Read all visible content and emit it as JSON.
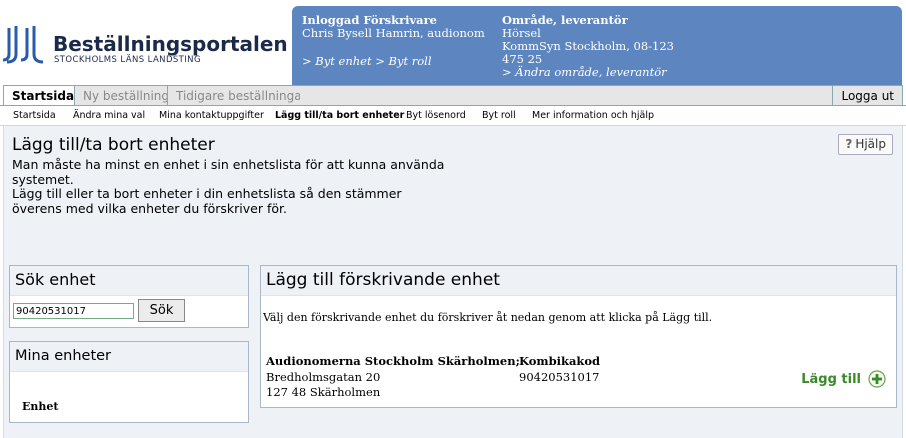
{
  "header": {
    "logo_title": "Beställningsportalen",
    "logo_subtitle": "STOCKHOLMS LÄNS LANDSTING",
    "logo_color": "#1c2a4a",
    "logo_mark_color": "#2a5ba8"
  },
  "infobox": {
    "bg_color": "#5d86c0",
    "user_heading": "Inloggad Förskrivare",
    "user_name": "Chris Bysell Hamrin, audionom",
    "user_links": "> Byt enhet > Byt roll",
    "area_heading": "Område, leverantör",
    "area_line1": "Hörsel",
    "area_line2": "KommSyn Stockholm, 08-123",
    "area_line3": "475 25",
    "area_link": "> Ändra område, leverantör"
  },
  "tabs": [
    {
      "label": "Startsida"
    },
    {
      "label": "Ny beställning"
    },
    {
      "label": "Tidigare beställningar"
    }
  ],
  "logout_label": "Logga ut",
  "subnav": [
    {
      "label": "Startsida"
    },
    {
      "label": "Ändra mina val"
    },
    {
      "label": "Mina kontaktuppgifter"
    },
    {
      "label": "Lägg till/ta bort enheter"
    },
    {
      "label": "Byt lösenord"
    },
    {
      "label": "Byt roll"
    },
    {
      "label": "Mer information och hjälp"
    }
  ],
  "page": {
    "title": "Lägg till/ta bort enheter",
    "intro_line1": "Man måste ha minst en enhet i sin enhetslista för att kunna använda systemet.",
    "intro_line2": "Lägg till eller ta bort enheter i din enhetslista så den stämmer överens med vilka enheter du förskriver för.",
    "help_label": "Hjälp"
  },
  "search": {
    "heading": "Sök enhet",
    "value": "90420531017",
    "button_label": "Sök"
  },
  "my_units": {
    "heading": "Mina enheter",
    "column_label": "Enhet"
  },
  "add_unit": {
    "heading": "Lägg till förskrivande enhet",
    "instruction": "Välj den förskrivande enhet du förskriver åt nedan genom att klicka på Lägg till.",
    "unit_name": "Audionomerna Stockholm Skärholmen;",
    "unit_address1": "Bredholmsgatan 20",
    "unit_address2": "127 48 Skärholmen",
    "code_label": "Kombikakod",
    "code_value": "90420531017",
    "add_label": "Lägg till",
    "add_color": "#3a8a2a"
  }
}
